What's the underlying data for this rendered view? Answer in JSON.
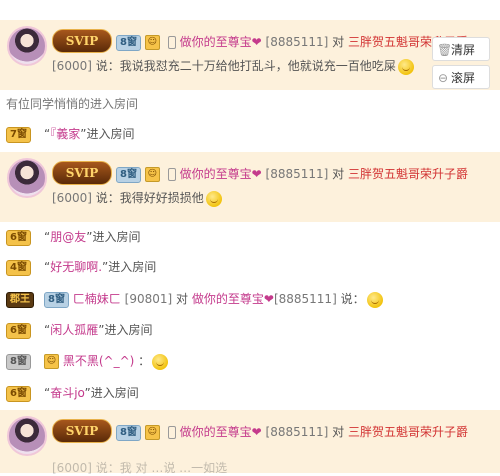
{
  "panel": {
    "clear_label": "清屏",
    "scroll_lock_label": "滚屏"
  },
  "messages": [
    {
      "svip": "SVIP",
      "badge": "8窗",
      "sender": "做你的至尊宝",
      "sender_id": "[8885111]",
      "to_word": "对",
      "target": "三胖贺五魁哥荣升子爵",
      "sender_num": "[6000]",
      "said": "说：",
      "text": "我说我怼充二十万给他打乱斗，他就说充一百他吃屎"
    },
    {
      "svip": "SVIP",
      "badge": "8窗",
      "sender": "做你的至尊宝",
      "sender_id": "[8885111]",
      "to_word": "对",
      "target": "三胖贺五魁哥荣升子爵",
      "sender_num": "[6000]",
      "said": "说：",
      "text": "我得好好损损他"
    },
    {
      "svip": "SVIP",
      "badge": "8窗",
      "sender": "做你的至尊宝",
      "sender_id": "[8885111]",
      "to_word": "对",
      "target": "三胖贺五魁哥荣升子爵"
    }
  ],
  "rows": {
    "r1": {
      "text": "有位同学悄悄的进入房间"
    },
    "r2": {
      "badge": "7窗",
      "name": "『義家",
      "suffix": "进入房间"
    },
    "r3": {
      "badge": "6窗",
      "name": "朋@友",
      "suffix": "进入房间"
    },
    "r4": {
      "badge": "4窗",
      "name": "好无聊啊.",
      "suffix": "进入房间"
    },
    "r5": {
      "badge": "郡王",
      "badge2": "8窗",
      "sender": "ㄈ楠妹ㄈ",
      "sender_id": "[90801]",
      "to_word": "对",
      "target": "做你的至尊宝",
      "target_id": "[8885111]",
      "said": "说："
    },
    "r6": {
      "badge": "6窗",
      "name": "闲人孤雁",
      "suffix": "进入房间"
    },
    "r7": {
      "badge": "8窗",
      "name": "黑不黑(^_^)",
      "said": "："
    },
    "r8": {
      "badge": "6窗",
      "name": "奋斗jo",
      "suffix": "进入房间"
    }
  },
  "bottom_partial": "[6000] 说：我 对 …说 …一如选"
}
